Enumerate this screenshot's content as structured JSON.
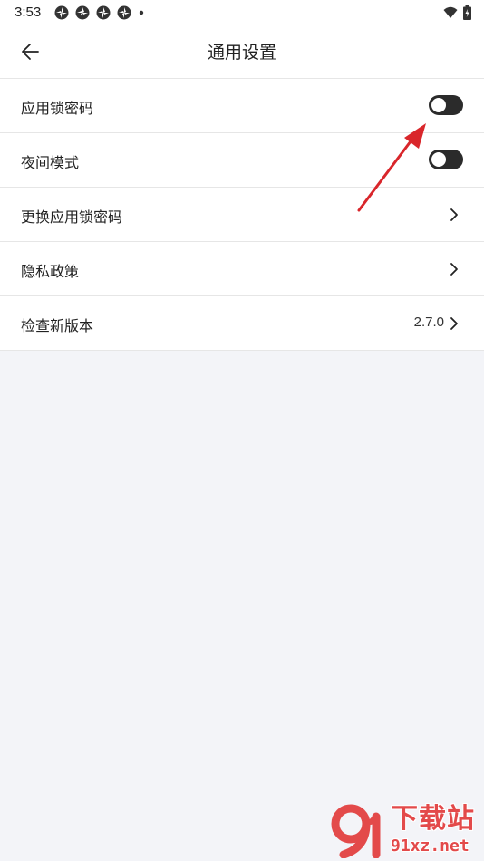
{
  "status_bar": {
    "time": "3:53",
    "notification_icons": [
      "pinwheel-icon",
      "pinwheel-icon",
      "pinwheel-icon",
      "pinwheel-icon",
      "dot-icon"
    ],
    "right_icons": [
      "wifi-icon",
      "battery-icon"
    ]
  },
  "header": {
    "title": "通用设置",
    "back_icon": "arrow-left-icon"
  },
  "settings": {
    "items": [
      {
        "label": "应用锁密码",
        "control": "toggle",
        "on": false
      },
      {
        "label": "夜间模式",
        "control": "toggle",
        "on": false
      },
      {
        "label": "更换应用锁密码",
        "control": "chevron"
      },
      {
        "label": "隐私政策",
        "control": "chevron"
      },
      {
        "label": "检查新版本",
        "control": "chevron",
        "value": "2.7.0"
      }
    ]
  },
  "watermark": {
    "title": "下载站",
    "url": "91xz.net"
  },
  "colors": {
    "background": "#f3f4f8",
    "surface": "#ffffff",
    "toggle_track": "#2b2b2b",
    "annotation_arrow": "#d9262b",
    "watermark": "#e34a4a"
  }
}
